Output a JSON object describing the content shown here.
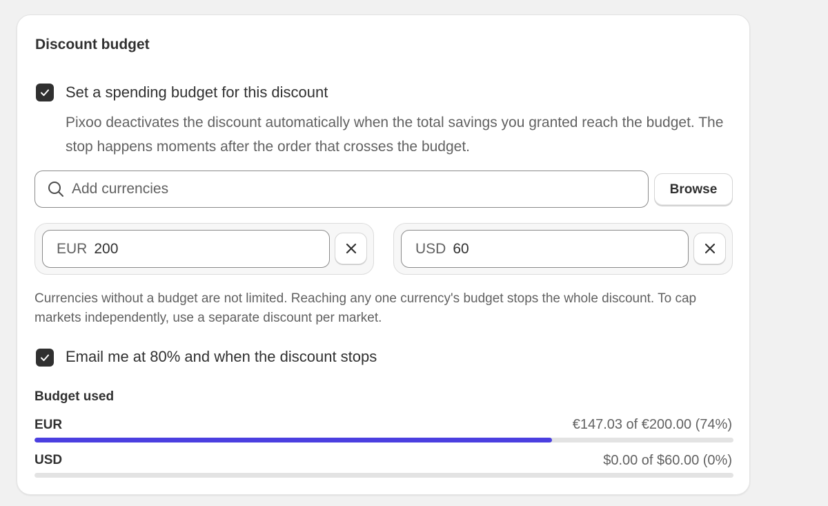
{
  "section": {
    "title": "Discount budget"
  },
  "spending_budget": {
    "checked": true,
    "label": "Set a spending budget for this discount",
    "help": "Pixoo deactivates the discount automatically when the total savings you granted reach the budget. The stop happens moments after the order that crosses the budget."
  },
  "currency_search": {
    "placeholder": "Add currencies",
    "value": "",
    "icon": "search-icon",
    "browse_label": "Browse"
  },
  "currency_budgets": [
    {
      "currency": "EUR",
      "amount": "200",
      "remove_icon": "close-icon"
    },
    {
      "currency": "USD",
      "amount": "60",
      "remove_icon": "close-icon"
    }
  ],
  "note": "Currencies without a budget are not limited. Reaching any one currency's budget stops the whole discount. To cap markets independently, use a separate discount per market.",
  "email_alert": {
    "checked": true,
    "label": "Email me at 80% and when the discount stops"
  },
  "budget_used": {
    "title": "Budget used",
    "rows": [
      {
        "currency": "EUR",
        "summary": "€147.03 of €200.00 (74%)",
        "percent": 74
      },
      {
        "currency": "USD",
        "summary": "$0.00 of $60.00 (0%)",
        "percent": 0
      }
    ]
  },
  "colors": {
    "progress_fill": "#4b3fe0",
    "progress_track": "#e3e3e3",
    "checkbox_fill": "#303030"
  }
}
